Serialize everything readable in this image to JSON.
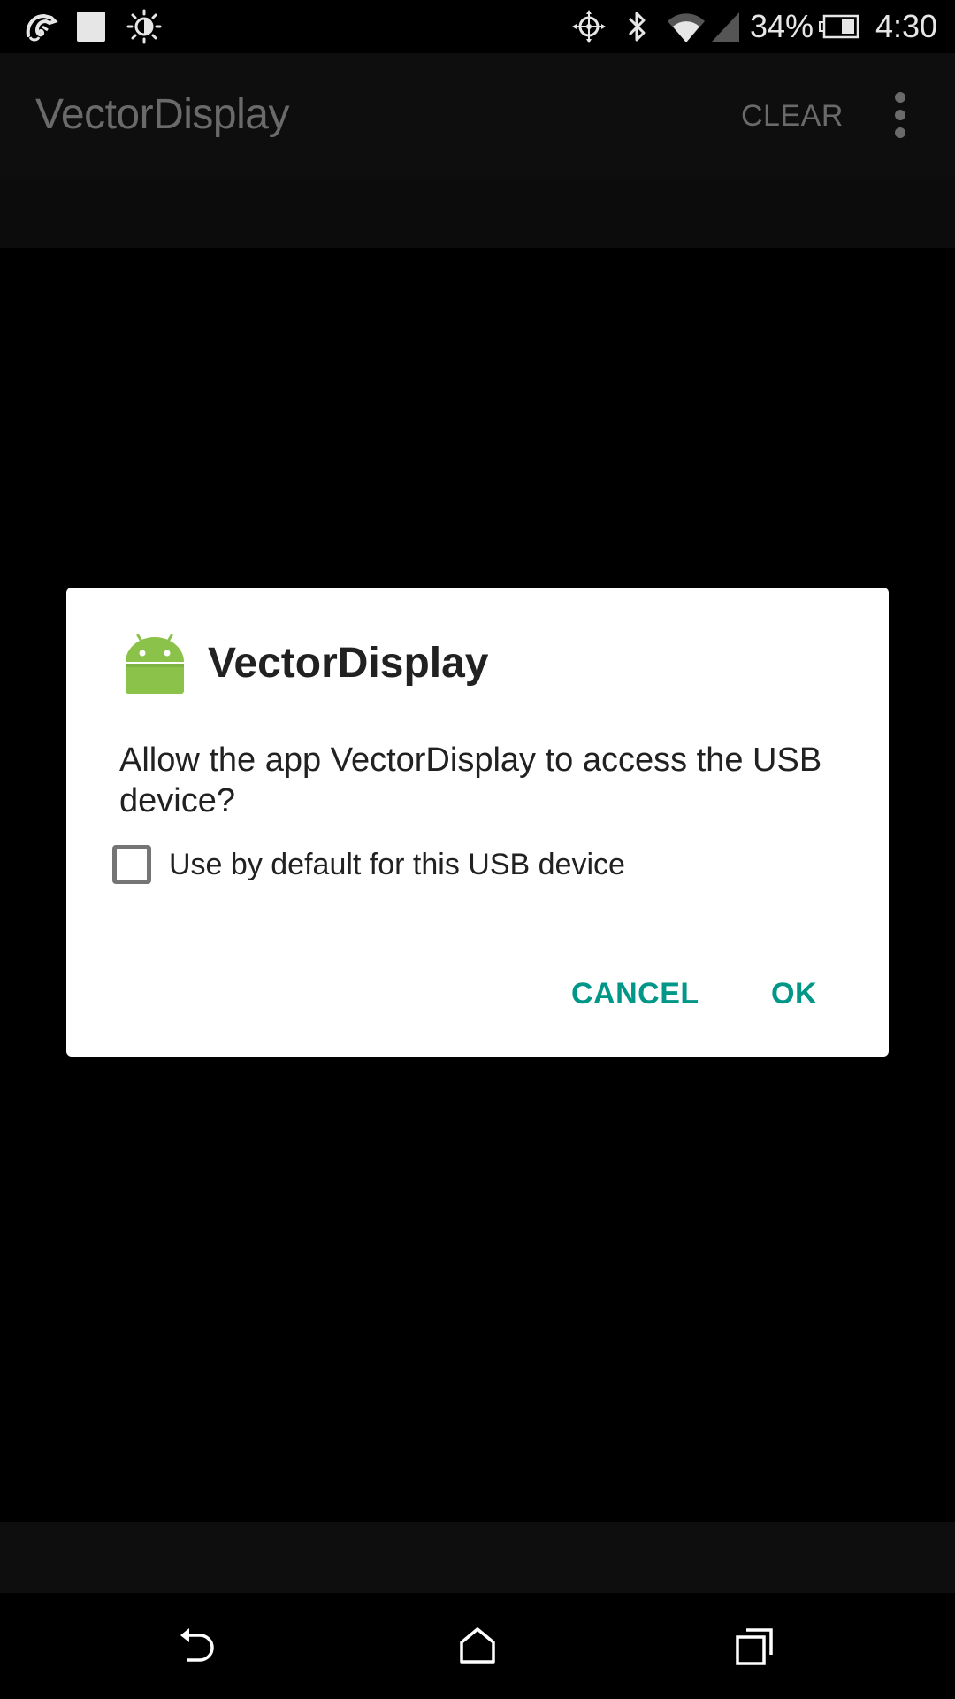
{
  "status_bar": {
    "left_icons": [
      "chameleon-icon",
      "square-notification-icon",
      "brightness-icon"
    ],
    "right_icons": [
      "location-icon",
      "bluetooth-icon",
      "wifi-icon",
      "cell-signal-icon",
      "battery-icon"
    ],
    "battery_percent": "34%",
    "time": "4:30"
  },
  "action_bar": {
    "title": "VectorDisplay",
    "clear_label": "CLEAR",
    "overflow_icon": "more-vert-icon"
  },
  "dialog": {
    "title": "VectorDisplay",
    "icon": "android-icon",
    "message": "Allow the app VectorDisplay to access the USB device?",
    "checkbox_label": "Use by default for this USB device",
    "checkbox_checked": false,
    "cancel_label": "CANCEL",
    "ok_label": "OK",
    "accent_color": "#009688"
  },
  "nav_bar": {
    "buttons": [
      "back-icon",
      "home-icon",
      "recents-icon"
    ]
  }
}
